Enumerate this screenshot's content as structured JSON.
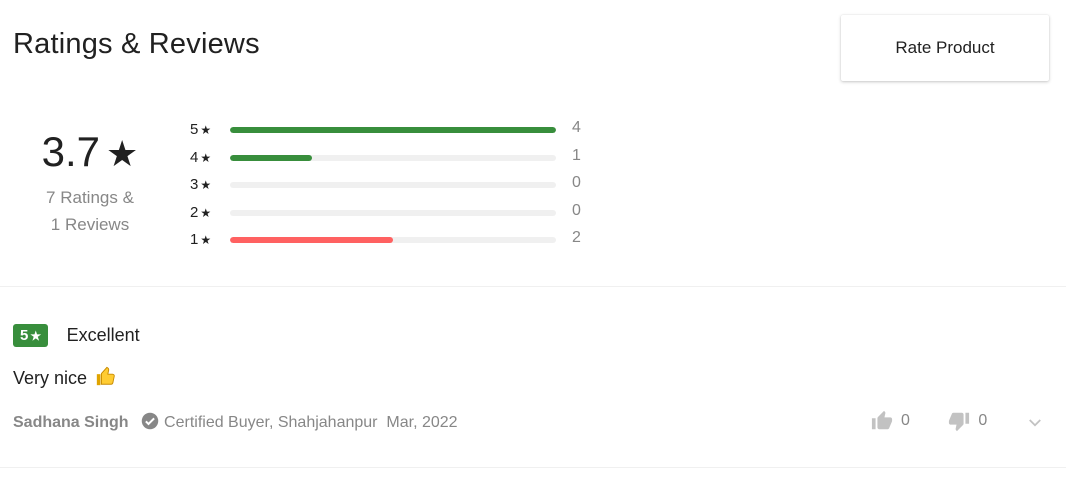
{
  "header": {
    "title": "Ratings & Reviews",
    "rate_button": "Rate Product"
  },
  "summary": {
    "average": "3.7",
    "star_glyph": "★",
    "ratings_line": "7 Ratings &",
    "reviews_line": "1 Reviews"
  },
  "breakdown": [
    {
      "stars": "5",
      "count": "4",
      "fraction": 1.0,
      "color": "#388e3c"
    },
    {
      "stars": "4",
      "count": "1",
      "fraction": 0.25,
      "color": "#388e3c"
    },
    {
      "stars": "3",
      "count": "0",
      "fraction": 0,
      "color": "#388e3c"
    },
    {
      "stars": "2",
      "count": "0",
      "fraction": 0,
      "color": "#ff9f00"
    },
    {
      "stars": "1",
      "count": "2",
      "fraction": 0.5,
      "color": "#ff6161"
    }
  ],
  "review": {
    "rating": "5",
    "star_glyph": "★",
    "title": "Excellent",
    "text": "Very nice",
    "emoji": "thumbs-up-emoji",
    "author": "Sadhana Singh",
    "certified": "Certified Buyer, Shahjahanpur",
    "date": "Mar, 2022",
    "likes": "0",
    "dislikes": "0",
    "badge_color": "#388e3c"
  },
  "icons": [
    "check-circle-icon",
    "thumbs-up-icon",
    "thumbs-down-icon",
    "chevron-down-icon"
  ]
}
